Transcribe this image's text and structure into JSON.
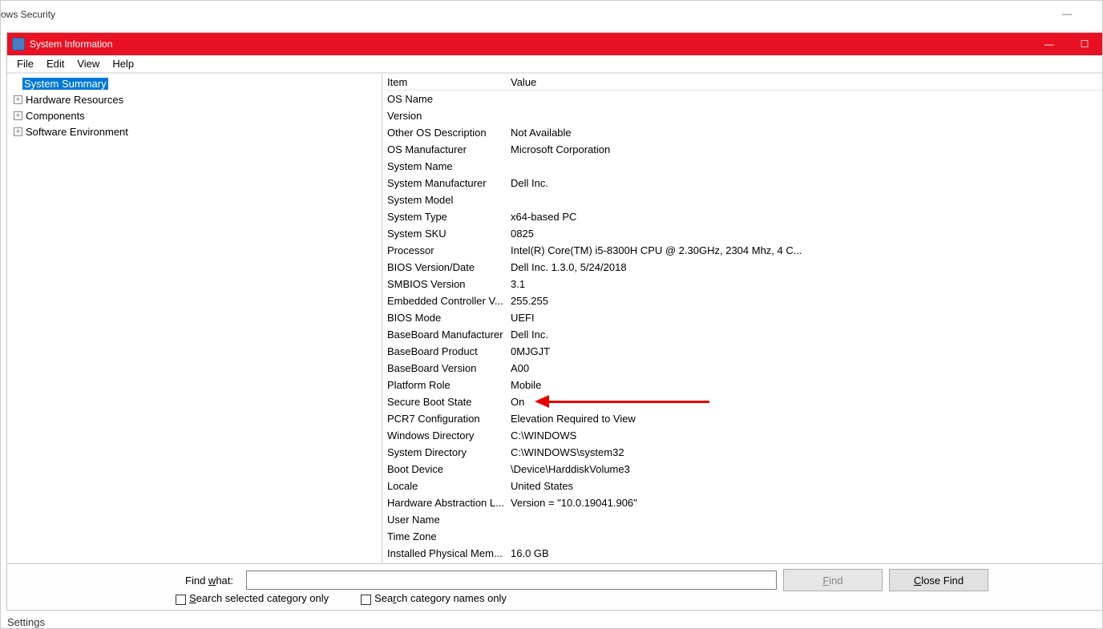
{
  "background": {
    "title_partial": "ows Security",
    "bottom_text": "Settings"
  },
  "window": {
    "title": "System Information"
  },
  "menu": {
    "file": "File",
    "edit": "Edit",
    "view": "View",
    "help": "Help"
  },
  "tree": {
    "system_summary": "System Summary",
    "hardware_resources": "Hardware Resources",
    "components": "Components",
    "software_environment": "Software Environment"
  },
  "columns": {
    "item": "Item",
    "value": "Value"
  },
  "rows": [
    {
      "item": "OS Name",
      "value": "",
      "redacted": true,
      "redact_w": 370
    },
    {
      "item": "Version",
      "value": "",
      "redacted": true,
      "redact_w": 180
    },
    {
      "item": "Other OS Description",
      "value": "Not Available"
    },
    {
      "item": "OS Manufacturer",
      "value": "Microsoft Corporation"
    },
    {
      "item": "System Name",
      "value": "",
      "redacted": true,
      "redact_w": 100
    },
    {
      "item": "System Manufacturer",
      "value": "Dell Inc."
    },
    {
      "item": "System Model",
      "value": "",
      "redacted": true,
      "redact_w": 90
    },
    {
      "item": "System Type",
      "value": "x64-based PC"
    },
    {
      "item": "System SKU",
      "value": "0825"
    },
    {
      "item": "Processor",
      "value": "Intel(R) Core(TM) i5-8300H CPU @ 2.30GHz, 2304 Mhz, 4 C..."
    },
    {
      "item": "BIOS Version/Date",
      "value": "Dell Inc. 1.3.0, 5/24/2018"
    },
    {
      "item": "SMBIOS Version",
      "value": "3.1"
    },
    {
      "item": "Embedded Controller V...",
      "value": "255.255"
    },
    {
      "item": "BIOS Mode",
      "value": "UEFI"
    },
    {
      "item": "BaseBoard Manufacturer",
      "value": "Dell Inc."
    },
    {
      "item": "BaseBoard Product",
      "value": "0MJGJT"
    },
    {
      "item": "BaseBoard Version",
      "value": "A00"
    },
    {
      "item": "Platform Role",
      "value": "Mobile"
    },
    {
      "item": "Secure Boot State",
      "value": "On",
      "arrow": true
    },
    {
      "item": "PCR7 Configuration",
      "value": "Elevation Required to View"
    },
    {
      "item": "Windows Directory",
      "value": "C:\\WINDOWS"
    },
    {
      "item": "System Directory",
      "value": "C:\\WINDOWS\\system32"
    },
    {
      "item": "Boot Device",
      "value": "\\Device\\HarddiskVolume3"
    },
    {
      "item": "Locale",
      "value": "United States"
    },
    {
      "item": "Hardware Abstraction L...",
      "value": "Version = \"10.0.19041.906\""
    },
    {
      "item": "User Name",
      "value": "",
      "redacted": true,
      "redact_w": 220
    },
    {
      "item": "Time Zone",
      "value": "",
      "redacted": true,
      "redact_w": 230
    },
    {
      "item": "Installed Physical Mem...",
      "value": "16.0 GB"
    }
  ],
  "find": {
    "label_prefix": "Find ",
    "label_u": "w",
    "label_suffix": "hat:",
    "find_btn_u": "F",
    "find_btn_suffix": "ind",
    "close_btn_u": "C",
    "close_btn_suffix": "lose Find",
    "cb1_u": "S",
    "cb1_suffix": "earch selected category only",
    "cb2_prefix": "Sea",
    "cb2_u": "r",
    "cb2_suffix": "ch category names only"
  }
}
